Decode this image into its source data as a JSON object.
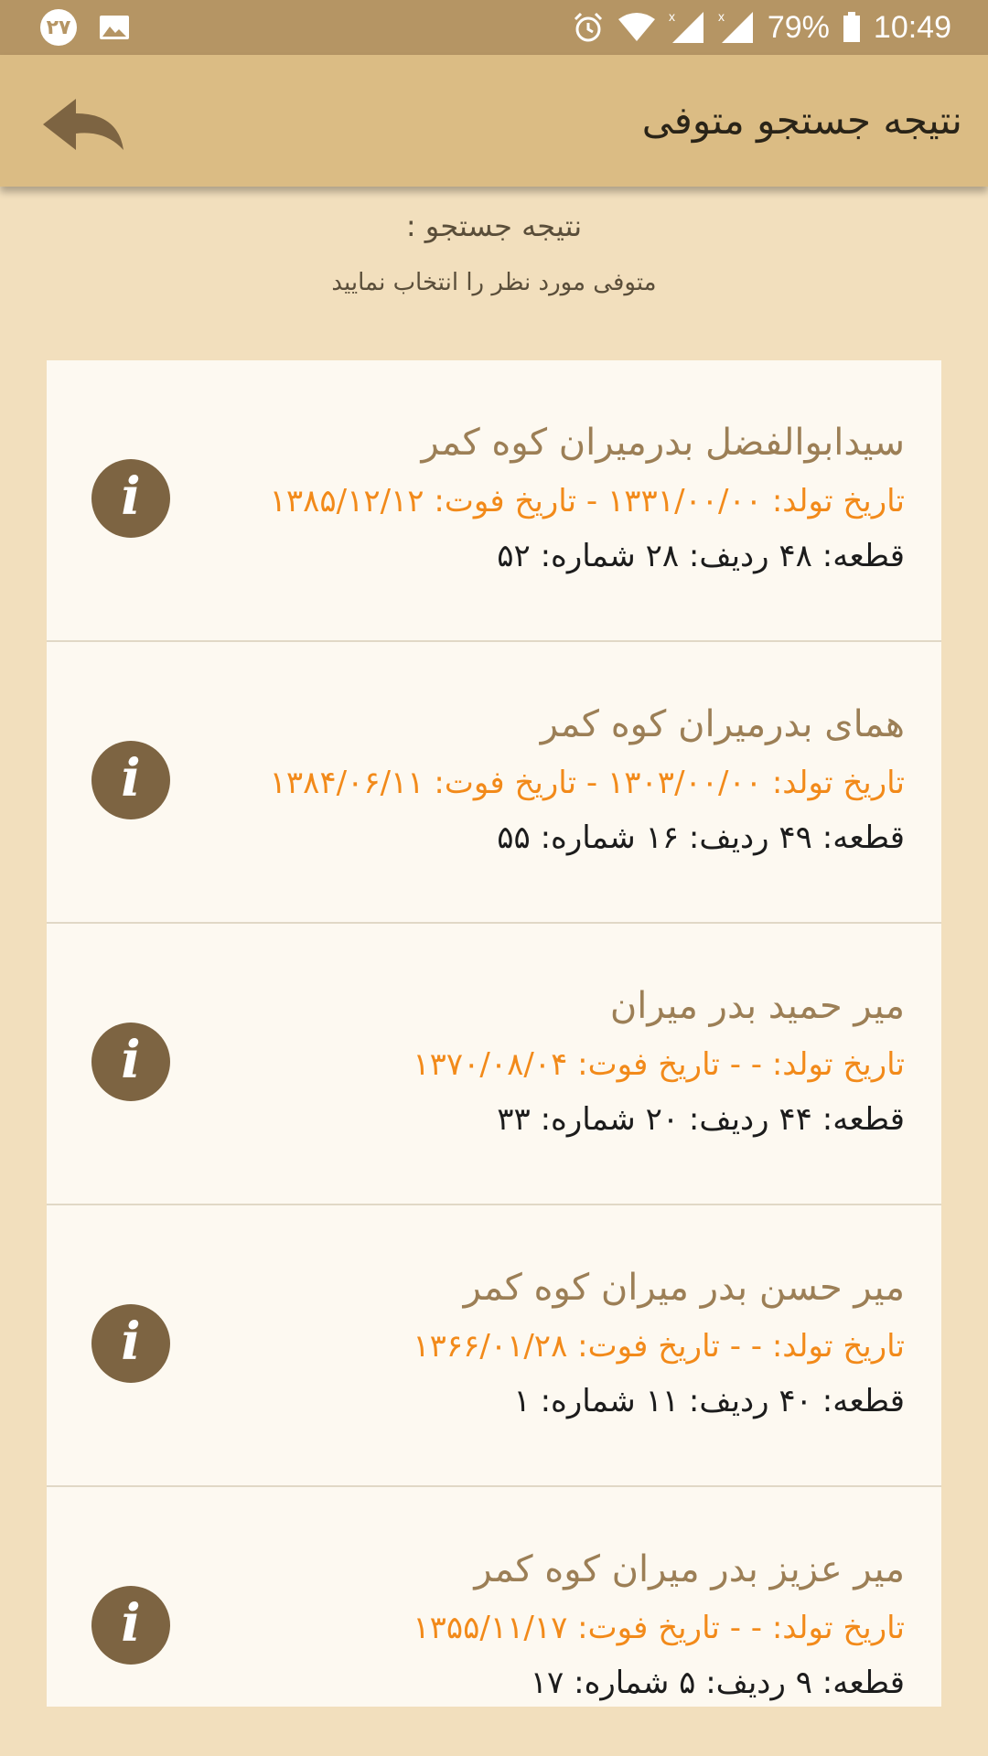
{
  "status_bar": {
    "notification_count": "۲۷",
    "battery_percent": "79%",
    "time": "10:49",
    "icons": [
      "gallery-icon",
      "alarm-icon",
      "wifi-icon",
      "signal-icon",
      "signal-icon",
      "battery-icon"
    ]
  },
  "app_bar": {
    "title": "نتیجه جستجو متوفی",
    "back_icon": "back-arrow-icon"
  },
  "header": {
    "result_label": "نتیجه جستجو :",
    "hint": "متوفی مورد نظر را انتخاب نمایید"
  },
  "results": [
    {
      "name": "سیدابوالفضل بدرمیران کوه کمر",
      "dates": "تاریخ تولد: ۱۳۳۱/۰۰/۰۰ - تاریخ فوت: ۱۳۸۵/۱۲/۱۲",
      "location": "قطعه: ۴۸ ردیف: ۲۸ شماره: ۵۲"
    },
    {
      "name": "همای بدرمیران کوه کمر",
      "dates": "تاریخ تولد: ۱۳۰۳/۰۰/۰۰ - تاریخ فوت: ۱۳۸۴/۰۶/۱۱",
      "location": "قطعه: ۴۹ ردیف: ۱۶ شماره: ۵۵"
    },
    {
      "name": "میر حمید بدر میران",
      "dates": "تاریخ تولد: - - تاریخ فوت: ۱۳۷۰/۰۸/۰۴",
      "location": "قطعه: ۴۴ ردیف: ۲۰ شماره: ۳۳"
    },
    {
      "name": "میر حسن  بدر میران کوه کمر",
      "dates": "تاریخ تولد: - - تاریخ فوت: ۱۳۶۶/۰۱/۲۸",
      "location": "قطعه: ۴۰ ردیف: ۱۱ شماره: ۱"
    },
    {
      "name": "میر عزیز بدر میران کوه کمر",
      "dates": "تاریخ تولد: - - تاریخ فوت: ۱۳۵۵/۱۱/۱۷",
      "location": "قطعه: ۹ ردیف: ۵ شماره: ۱۷"
    }
  ],
  "info_glyph": "i",
  "colors": {
    "status_bar": "#b59564",
    "app_bar": "#dbbc84",
    "background": "#f2dfbd",
    "card": "#fdf9f1",
    "name_text": "#9c7f56",
    "dates_text": "#f28a1a",
    "location_text": "#1c1c1c",
    "info_button": "#7d6442"
  }
}
